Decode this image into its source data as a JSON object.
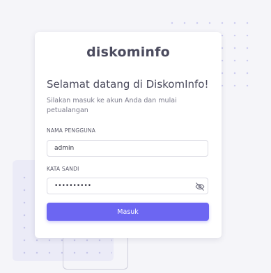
{
  "brand": {
    "logo_text": "diskominfo"
  },
  "login": {
    "title": "Selamat datang di DiskomInfo!",
    "subtitle": "Silakan masuk ke akun Anda dan mulai petualangan",
    "username_label": "NAMA PENGGUNA",
    "username_value": "admin",
    "password_label": "KATA SANDI",
    "password_value": "adminpassw",
    "submit_label": "Masuk",
    "password_toggle_icon": "eye-slash-icon"
  },
  "colors": {
    "accent": "#6c66f2",
    "background": "#f5f5f9",
    "card": "#ffffff",
    "title_text": "#4a4a5c"
  }
}
